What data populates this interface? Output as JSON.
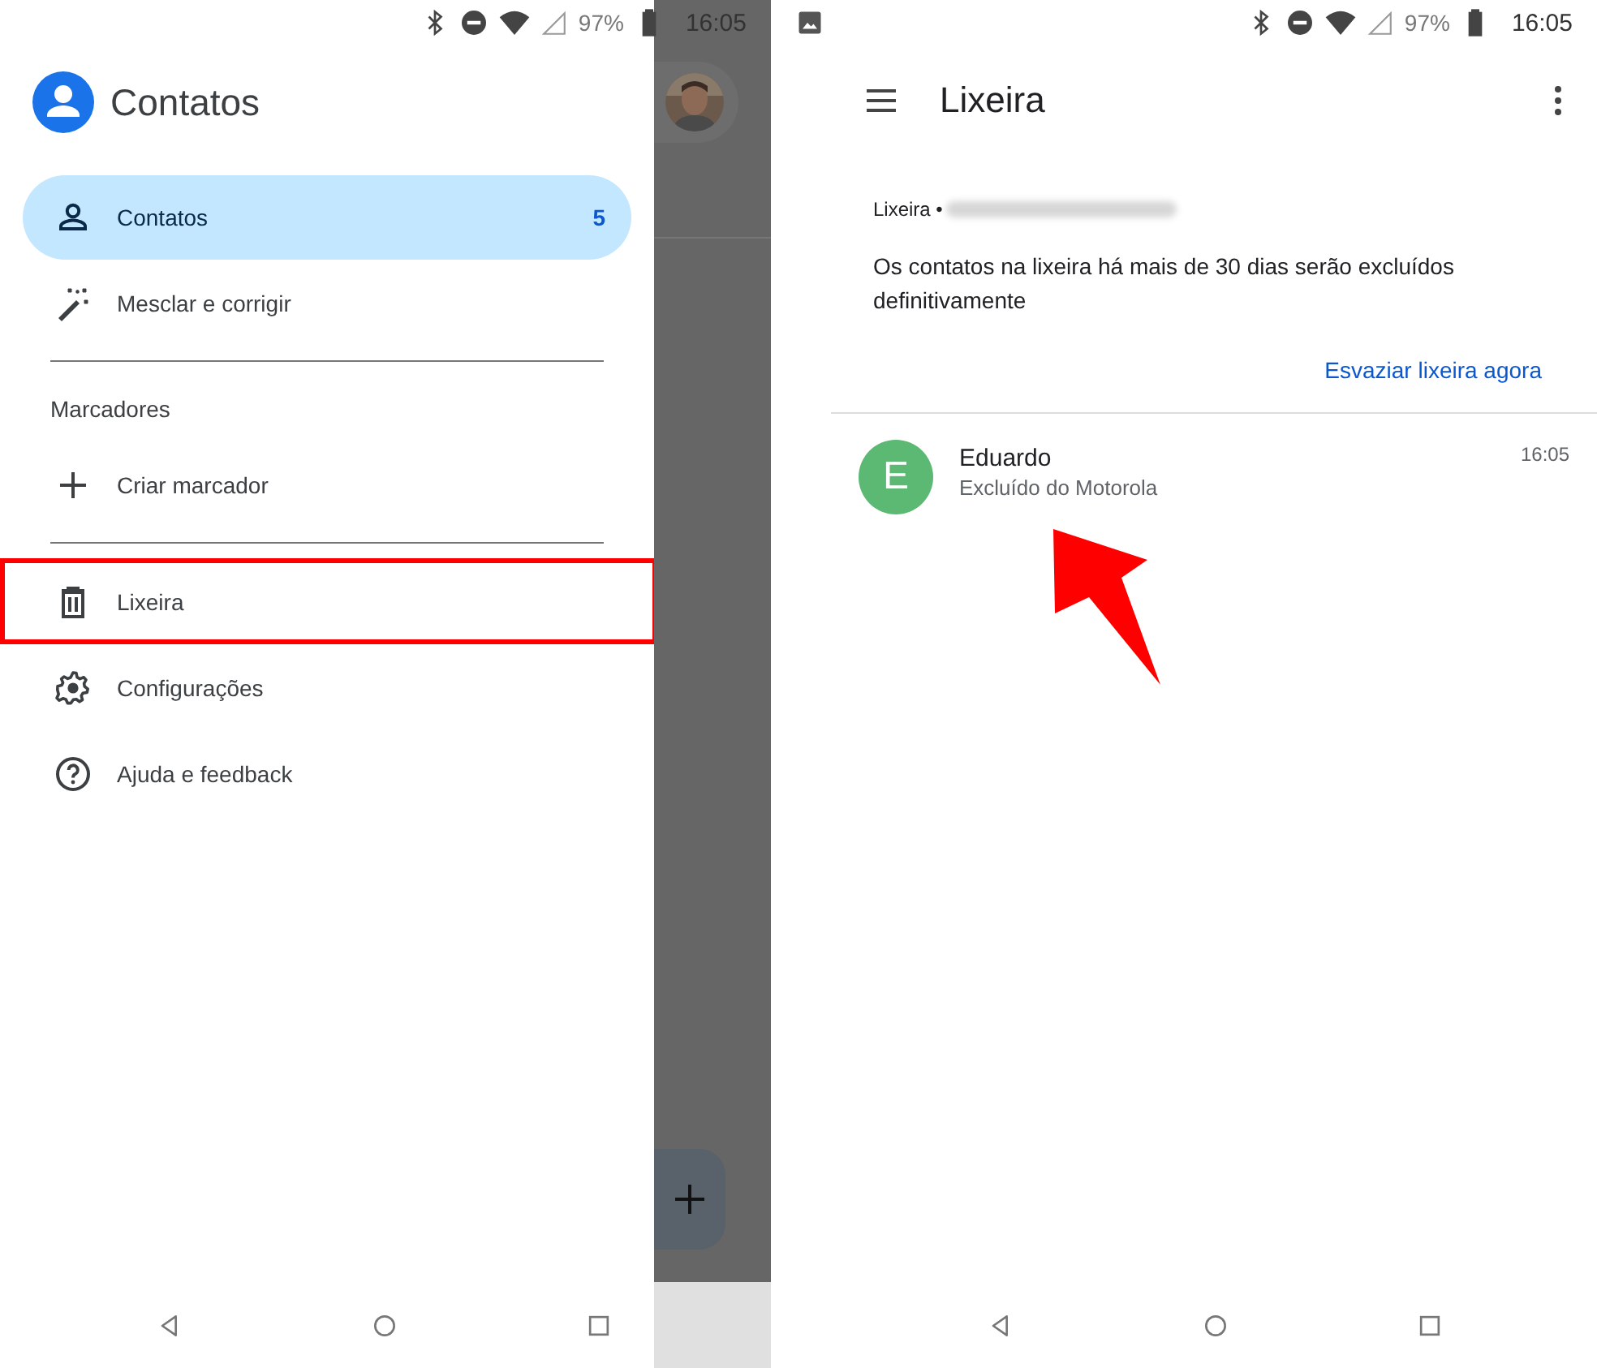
{
  "left_screen": {
    "status_bar": {
      "battery": "97%",
      "time": "16:05"
    },
    "drawer": {
      "app_title": "Contatos",
      "sections": [
        {
          "items": [
            {
              "label": "Contatos",
              "count": "5",
              "selected": true,
              "highlighted": false
            },
            {
              "label": "Mesclar e corrigir",
              "selected": false,
              "highlighted": false
            }
          ]
        },
        {
          "heading": "Marcadores",
          "items": [
            {
              "label": "Criar marcador",
              "selected": false,
              "highlighted": false
            }
          ]
        },
        {
          "items": [
            {
              "label": "Lixeira",
              "selected": false,
              "highlighted": true
            },
            {
              "label": "Configurações",
              "selected": false,
              "highlighted": false
            },
            {
              "label": "Ajuda e feedback",
              "selected": false,
              "highlighted": false
            }
          ]
        }
      ]
    }
  },
  "right_screen": {
    "status_bar": {
      "battery": "97%",
      "time": "16:05"
    },
    "toolbar": {
      "title": "Lixeira"
    },
    "trash_info": {
      "label": "Lixeira •",
      "message": "Os contatos na lixeira há mais de 30 dias serão excluídos definitivamente",
      "action": "Esvaziar lixeira agora"
    },
    "contacts": [
      {
        "initial": "E",
        "name": "Eduardo",
        "subtitle": "Excluído do Motorola",
        "time": "16:05",
        "color": "#5bb974"
      }
    ]
  }
}
